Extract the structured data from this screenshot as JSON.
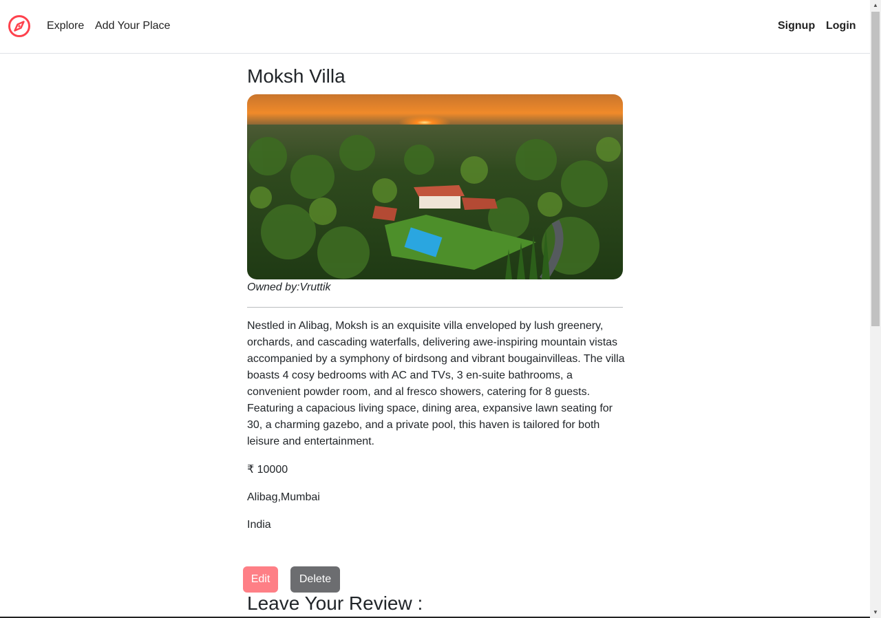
{
  "nav": {
    "brand_icon": "compass-icon",
    "links": {
      "explore": "Explore",
      "add_place": "Add Your Place",
      "signup": "Signup",
      "login": "Login"
    },
    "brand_color": "#fe424d"
  },
  "listing": {
    "title": "Moksh Villa",
    "image_alt": "aerial-villa-photo",
    "owner": "Owned by:Vruttik",
    "description": "Nestled in Alibag, Moksh is an exquisite villa enveloped by lush greenery, orchards, and cascading waterfalls, delivering awe-inspiring mountain vistas accompanied by a symphony of birdsong and vibrant bougainvilleas. The villa boasts 4 cosy bedrooms with AC and TVs, 3 en-suite bathrooms, a convenient powder room, and al fresco showers, catering for 8 guests. Featuring a capacious living space, dining area, expansive lawn seating for 30, a charming gazebo, and a private pool, this haven is tailored for both leisure and entertainment.",
    "price": "₹ 10000",
    "location": "Alibag,Mumbai",
    "country": "India"
  },
  "actions": {
    "edit_label": "Edit",
    "delete_label": "Delete",
    "edit_color": "#fe7f86",
    "delete_color": "#6c6d70"
  },
  "review": {
    "heading": "Leave Your Review :"
  }
}
